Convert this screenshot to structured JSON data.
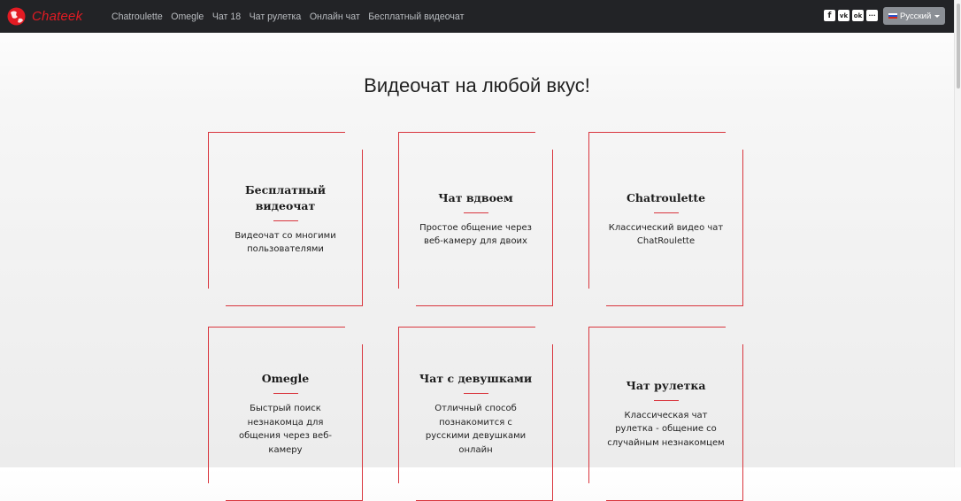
{
  "header": {
    "brand": "Chateek",
    "nav": [
      "Chatroulette",
      "Omegle",
      "Чат 18",
      "Чат рулетка",
      "Онлайн чат",
      "Бесплатный видеочат"
    ],
    "social": [
      {
        "icon": "facebook-icon",
        "glyph": "f"
      },
      {
        "icon": "vk-icon",
        "glyph": "vk"
      },
      {
        "icon": "odnoklassniki-icon",
        "glyph": "ok"
      },
      {
        "icon": "more-icon",
        "glyph": "···"
      }
    ],
    "language": "Русский"
  },
  "main": {
    "title": "Видеочат на любой вкус!",
    "cards": [
      {
        "title": "Бесплатный видеочат",
        "desc": "Видеочат со многими пользователями"
      },
      {
        "title": "Чат вдвоем",
        "desc": "Простое общение через веб-камеру для двоих"
      },
      {
        "title": "Chatroulette",
        "desc": "Классический видео чат ChatRoulette"
      },
      {
        "title": "Omegle",
        "desc": "Быстрый поиск незнакомца для общения через веб-камеру"
      },
      {
        "title": "Чат с девушками",
        "desc": "Отличный способ познакомится с русскими девушками онлайн"
      },
      {
        "title": "Чат рулетка",
        "desc": "Классическая чат рулетка - общение со случайным незнакомцем"
      }
    ]
  },
  "colors": {
    "navbar": "#222326",
    "accent": "#d9363e",
    "brand": "#e31b23"
  }
}
